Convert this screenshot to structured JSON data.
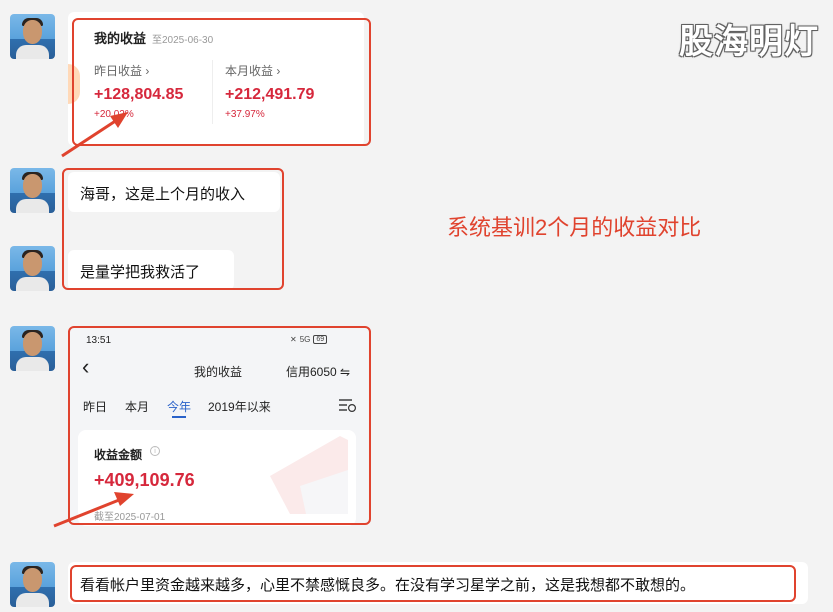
{
  "watermark": "股海明灯",
  "annotation": "系统基训2个月的收益对比",
  "card1": {
    "title": "我的收益",
    "date": "至2025-06-30",
    "yesterday_label": "昨日收益 ›",
    "yesterday_value": "+128,804.85",
    "yesterday_pct": "+20.02%",
    "month_label": "本月收益 ›",
    "month_value": "+212,491.79",
    "month_pct": "+37.97%"
  },
  "messages": {
    "m1": "海哥，这是上个月的收入",
    "m2": "是量学把我救活了",
    "m3": "看看帐户里资金越来越多，心里不禁感慨良多。在没有学习星学之前，这是我想都不敢想的。"
  },
  "card2": {
    "time": "13:51",
    "status_icons": "5G",
    "battery": "69",
    "back": "‹",
    "title": "我的收益",
    "credit": "信用6050 ⇋",
    "tabs": [
      "昨日",
      "本月",
      "今年",
      "2019年以来"
    ],
    "active_tab_index": 2,
    "filter_icon": "filter-clock-icon",
    "amount_label": "收益金额",
    "amount_value": "+409,109.76",
    "date_partial": "截至2025-07-01"
  },
  "colors": {
    "accent_red": "#e0432e",
    "value_red": "#d6283c",
    "tab_blue": "#2a62c9"
  }
}
